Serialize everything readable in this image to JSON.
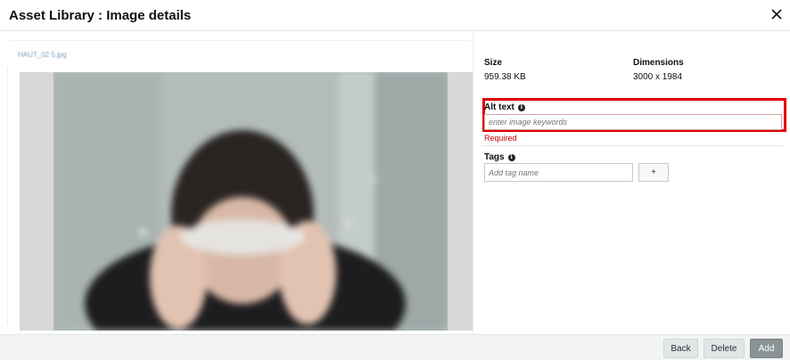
{
  "header": {
    "title": "Asset Library : Image details",
    "close_icon": "close-icon"
  },
  "image": {
    "filename": "HAUT_02 5.jpg"
  },
  "details": {
    "size_label": "Size",
    "size_value": "959.38 KB",
    "dimensions_label": "Dimensions",
    "dimensions_value": "3000 x 1984"
  },
  "alt_text": {
    "label": "Alt text",
    "info_icon": "info-icon",
    "placeholder": "enter image keywords",
    "value": "",
    "error": "Required",
    "highlight_color": "#e00000"
  },
  "tags": {
    "label": "Tags",
    "info_icon": "info-icon",
    "placeholder": "Add tag name",
    "add_label": "+"
  },
  "footer": {
    "back_label": "Back",
    "delete_label": "Delete",
    "add_label": "Add"
  }
}
